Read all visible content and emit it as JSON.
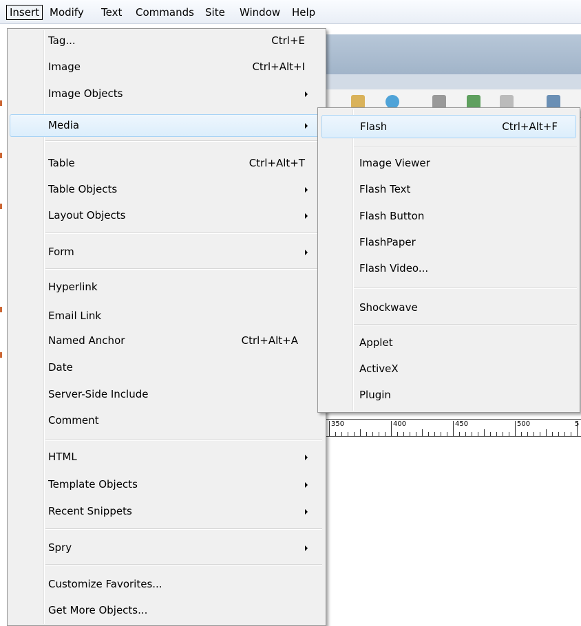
{
  "menubar": {
    "items": [
      "Insert",
      "Modify",
      "Text",
      "Commands",
      "Site",
      "Window",
      "Help"
    ]
  },
  "insert_menu": {
    "items": [
      {
        "label": "Tag...",
        "shortcut": "Ctrl+E"
      },
      {
        "label": "Image",
        "shortcut": "Ctrl+Alt+I"
      },
      {
        "label": "Image Objects",
        "submenu": true
      },
      {
        "label": "Media",
        "submenu": true,
        "highlighted": true
      },
      {
        "label": "Table",
        "shortcut": "Ctrl+Alt+T"
      },
      {
        "label": "Table Objects",
        "submenu": true
      },
      {
        "label": "Layout Objects",
        "submenu": true
      },
      {
        "label": "Form",
        "submenu": true
      },
      {
        "label": "Hyperlink"
      },
      {
        "label": "Email Link"
      },
      {
        "label": "Named Anchor",
        "shortcut": "Ctrl+Alt+A"
      },
      {
        "label": "Date"
      },
      {
        "label": "Server-Side Include"
      },
      {
        "label": "Comment"
      },
      {
        "label": "HTML",
        "submenu": true
      },
      {
        "label": "Template Objects",
        "submenu": true
      },
      {
        "label": "Recent Snippets",
        "submenu": true
      },
      {
        "label": "Spry",
        "submenu": true
      },
      {
        "label": "Customize Favorites..."
      },
      {
        "label": "Get More Objects..."
      }
    ]
  },
  "media_submenu": {
    "items": [
      {
        "label": "Flash",
        "shortcut": "Ctrl+Alt+F",
        "highlighted": true
      },
      {
        "label": "Image Viewer"
      },
      {
        "label": "Flash Text"
      },
      {
        "label": "Flash Button"
      },
      {
        "label": "FlashPaper"
      },
      {
        "label": "Flash Video..."
      },
      {
        "label": "Shockwave"
      },
      {
        "label": "Applet"
      },
      {
        "label": "ActiveX"
      },
      {
        "label": "Plugin"
      }
    ]
  },
  "ruler": {
    "labels": [
      "350",
      "400",
      "450",
      "500",
      "5"
    ]
  },
  "colors": {
    "highlight_border": "#a8d3f5",
    "menu_bg": "#f0f0f0",
    "titlebar": "#a1b4c9"
  }
}
